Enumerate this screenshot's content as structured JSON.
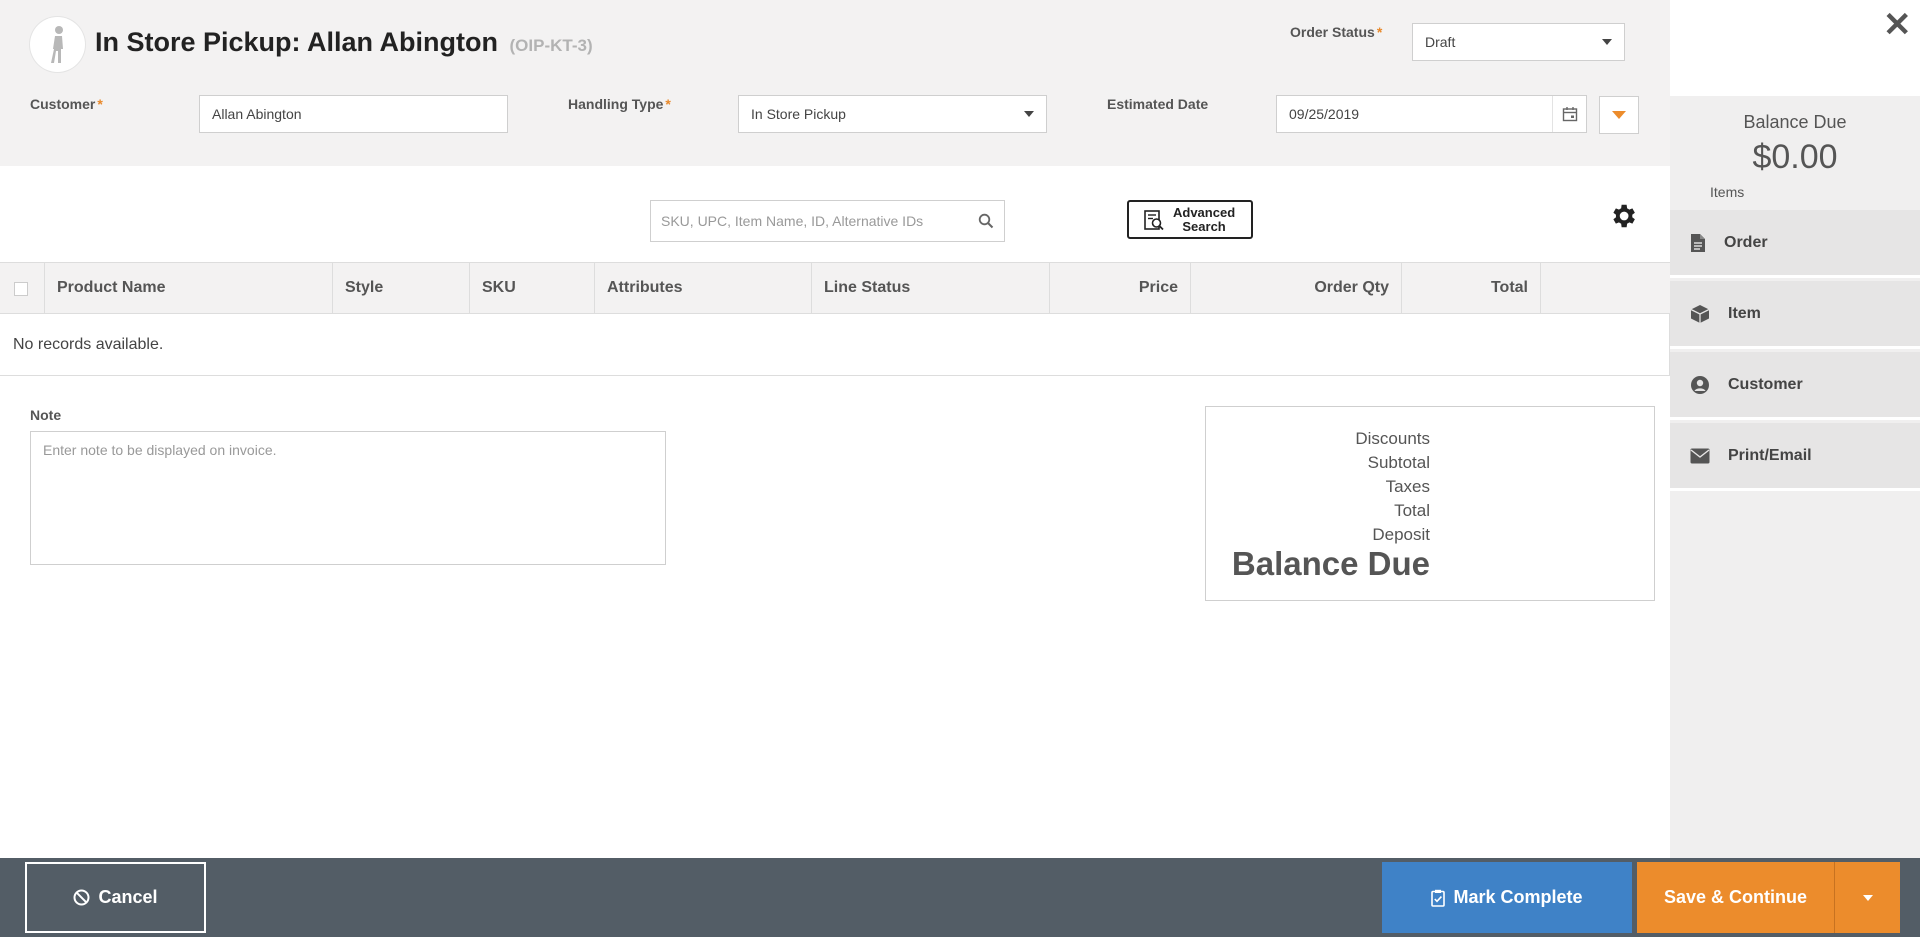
{
  "header": {
    "title": "In Store Pickup: Allan Abington",
    "order_code": "(OIP-KT-3)",
    "order_status_label": "Order Status",
    "order_status_value": "Draft",
    "customer_label": "Customer",
    "customer_value": "Allan Abington",
    "handling_type_label": "Handling Type",
    "handling_type_value": "In Store Pickup",
    "estimated_date_label": "Estimated Date",
    "estimated_date_value": "09/25/2019",
    "required_mark": "*",
    "close_icon": "close-icon"
  },
  "search": {
    "placeholder": "SKU, UPC, Item Name, ID, Alternative IDs",
    "advanced_label_1": "Advanced",
    "advanced_label_2": "Search"
  },
  "table": {
    "columns": [
      "Product Name",
      "Style",
      "SKU",
      "Attributes",
      "Line Status",
      "Price",
      "Order Qty",
      "Total"
    ],
    "empty_message": "No records available."
  },
  "note": {
    "label": "Note",
    "placeholder": "Enter note to be displayed on invoice."
  },
  "totals": {
    "discounts": "Discounts",
    "subtotal": "Subtotal",
    "taxes": "Taxes",
    "total": "Total",
    "deposit": "Deposit",
    "balance_due": "Balance Due"
  },
  "side_panel": {
    "balance_title": "Balance Due",
    "balance_amount": "$0.00",
    "items_label": "Items",
    "nav": [
      {
        "label": "Order",
        "icon": "document-icon"
      },
      {
        "label": "Item",
        "icon": "box-icon"
      },
      {
        "label": "Customer",
        "icon": "user-circle-icon"
      },
      {
        "label": "Print/Email",
        "icon": "envelope-icon"
      }
    ]
  },
  "footer": {
    "cancel_label": "Cancel",
    "mark_complete_label": "Mark Complete",
    "save_continue_label": "Save & Continue"
  },
  "colors": {
    "accent_orange": "#ec8c2c",
    "accent_blue": "#3f82c7",
    "footer_bg": "#535d66"
  }
}
